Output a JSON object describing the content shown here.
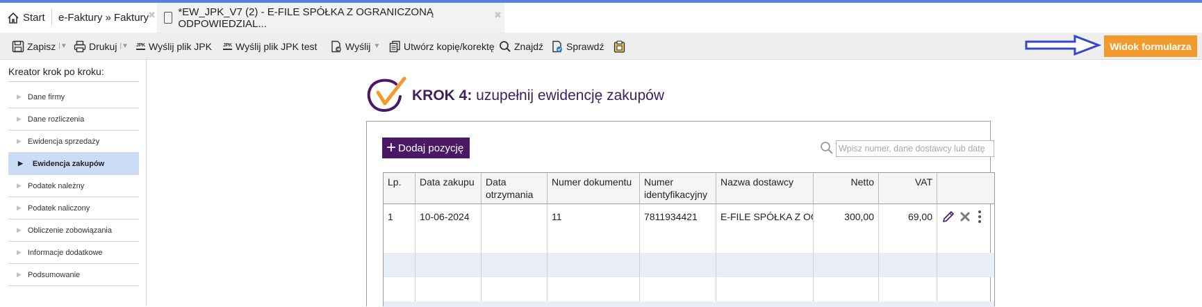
{
  "tabs": {
    "start_label": "Start",
    "faktury_label": "e-Faktury » Faktury",
    "active_label": "*EW_JPK_V7 (2) - E-FILE SPÓŁKA Z OGRANICZONĄ ODPOWIEDZIAL...",
    "close_glyph": "✖"
  },
  "toolbar": {
    "zapisz": "Zapisz",
    "drukuj": "Drukuj",
    "jpk_icon": "JPK",
    "wyslij_jpk": "Wyślij plik JPK",
    "wyslij_jpk_test": "Wyślij plik JPK test",
    "wyslij": "Wyślij",
    "utworz_kopie": "Utwórz kopię/korektę",
    "znajdz": "Znajdź",
    "sprawdz": "Sprawdź",
    "widok_formularza": "Widok formularza"
  },
  "sidebar": {
    "title": "Kreator krok po kroku:",
    "items": [
      {
        "label": "Dane firmy",
        "active": false
      },
      {
        "label": "Dane rozliczenia",
        "active": false
      },
      {
        "label": "Ewidencja sprzedaży",
        "active": false
      },
      {
        "label": "Ewidencja zakupów",
        "active": true
      },
      {
        "label": "Podatek należny",
        "active": false
      },
      {
        "label": "Podatek naliczony",
        "active": false
      },
      {
        "label": "Obliczenie zobowiązania",
        "active": false
      },
      {
        "label": "Informacje dodatkowe",
        "active": false
      },
      {
        "label": "Podsumowanie",
        "active": false
      }
    ]
  },
  "main": {
    "step_bold": "KROK 4:",
    "step_text": " uzupełnij ewidencję zakupów",
    "add_button": "Dodaj pozycję",
    "search_placeholder": "Wpisz numer, dane dostawcy lub datę",
    "columns": [
      "Lp.",
      "Data zakupu",
      "Data otrzymania",
      "Numer dokumentu",
      "Numer identyfikacyjny",
      "Nazwa dostawcy",
      "Netto",
      "VAT"
    ],
    "rows": [
      [
        "1",
        "10-06-2024",
        "",
        "11",
        "7811934421",
        "E-FILE SPÓŁKA Z OGRANICZONĄ",
        "300,00",
        "69,00"
      ]
    ]
  },
  "colors": {
    "accent_purple": "#4b1868",
    "accent_orange": "#f39a2c",
    "arrow_blue": "#3348c8",
    "active_sidebar": "#cbdcf7"
  }
}
